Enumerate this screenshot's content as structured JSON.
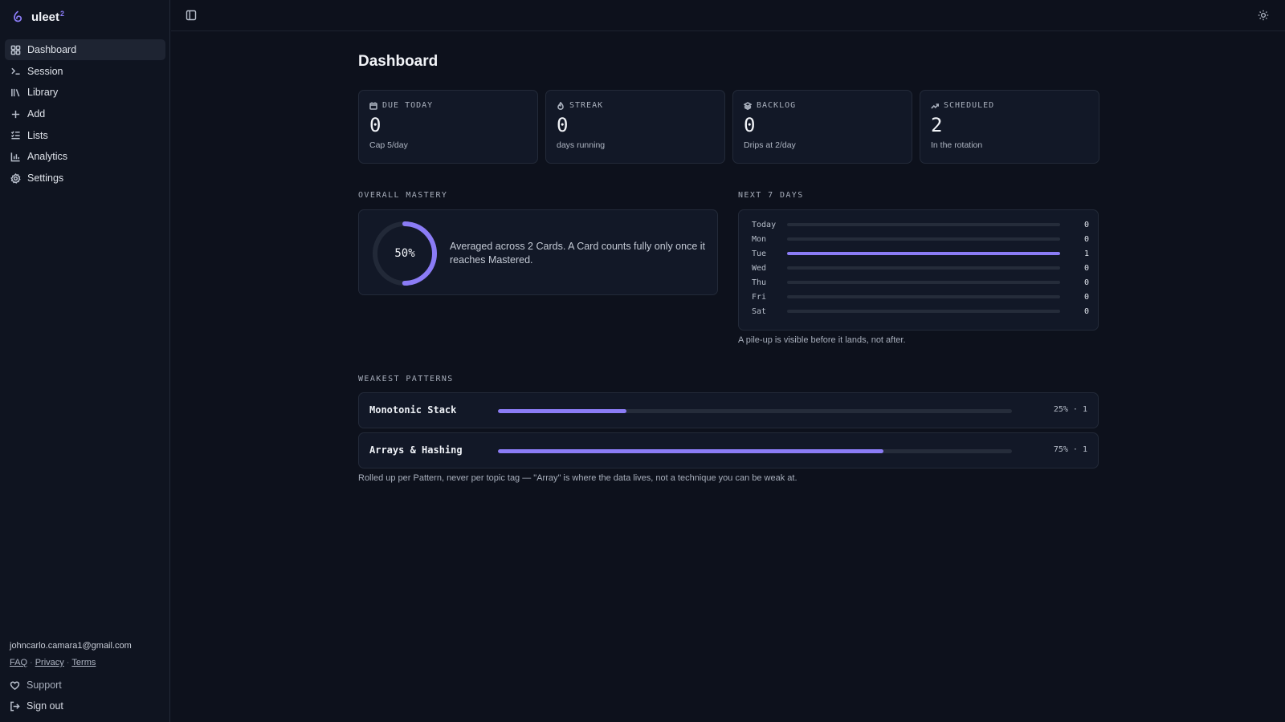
{
  "brand": {
    "name": "uleet",
    "sup": "2"
  },
  "nav": [
    {
      "label": "Dashboard",
      "icon": "dashboard-icon",
      "active": true
    },
    {
      "label": "Session",
      "icon": "terminal-icon"
    },
    {
      "label": "Library",
      "icon": "library-icon"
    },
    {
      "label": "Add",
      "icon": "plus-icon"
    },
    {
      "label": "Lists",
      "icon": "list-icon"
    },
    {
      "label": "Analytics",
      "icon": "chart-icon"
    },
    {
      "label": "Settings",
      "icon": "gear-icon"
    }
  ],
  "user": {
    "email": "johncarlo.camara1@gmail.com",
    "links": [
      "FAQ",
      "Privacy",
      "Terms"
    ],
    "support_label": "Support",
    "signout_label": "Sign out"
  },
  "page": {
    "title": "Dashboard"
  },
  "stats": [
    {
      "label": "DUE TODAY",
      "value": "0",
      "sub": "Cap 5/day",
      "icon": "calendar-icon"
    },
    {
      "label": "STREAK",
      "value": "0",
      "sub": "days running",
      "icon": "flame-icon"
    },
    {
      "label": "BACKLOG",
      "value": "0",
      "sub": "Drips at 2/day",
      "icon": "layers-icon"
    },
    {
      "label": "SCHEDULED",
      "value": "2",
      "sub": "In the rotation",
      "icon": "trending-up-icon"
    }
  ],
  "mastery": {
    "label": "OVERALL MASTERY",
    "percent_text": "50%",
    "percent": 50,
    "description": "Averaged across 2 Cards. A Card counts fully only once it reaches Mastered."
  },
  "next7": {
    "label": "NEXT 7 DAYS",
    "max": 1,
    "days": [
      {
        "name": "Today",
        "count": 0
      },
      {
        "name": "Mon",
        "count": 0
      },
      {
        "name": "Tue",
        "count": 1
      },
      {
        "name": "Wed",
        "count": 0
      },
      {
        "name": "Thu",
        "count": 0
      },
      {
        "name": "Fri",
        "count": 0
      },
      {
        "name": "Sat",
        "count": 0
      }
    ],
    "note": "A pile-up is visible before it lands, not after."
  },
  "weakest": {
    "label": "WEAKEST PATTERNS",
    "patterns": [
      {
        "name": "Monotonic Stack",
        "percent": 25,
        "stat": "25% · 1"
      },
      {
        "name": "Arrays & Hashing",
        "percent": 75,
        "stat": "75% · 1"
      }
    ],
    "note": "Rolled up per Pattern, never per topic tag — \"Array\" is where the data lives, not a technique you can be weak at."
  },
  "colors": {
    "accent": "#8b7cf6",
    "background": "#0d111c",
    "card": "#121827"
  }
}
